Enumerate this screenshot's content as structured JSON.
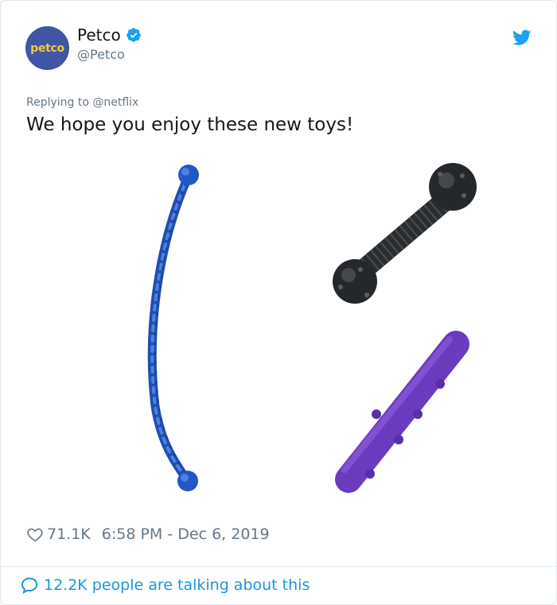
{
  "author": {
    "avatar_text": "petco",
    "display_name": "Petco",
    "handle": "@Petco"
  },
  "tweet": {
    "reply_to": "Replying to @netflix",
    "text": "We hope you enjoy these new toys!",
    "likes": "71.1K",
    "timestamp": "6:58 PM - Dec 6, 2019"
  },
  "footer": {
    "talking": "12.2K people are talking about this"
  },
  "icons": {
    "verified": "verified-badge-icon",
    "bird": "twitter-bird-icon",
    "heart": "heart-icon",
    "speech": "speech-bubble-icon"
  },
  "colors": {
    "twitter_blue": "#1da1f2",
    "link_blue": "#1b95e0",
    "muted_text": "#657786",
    "avatar_bg": "#3f56a6",
    "avatar_text": "#f3c847",
    "rope_toy": "#1d4fb0",
    "spiky_toy": "#2a2d30",
    "purple_toy": "#6a3bbf"
  }
}
